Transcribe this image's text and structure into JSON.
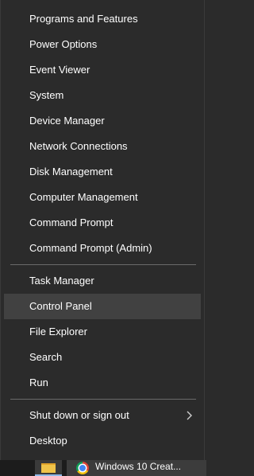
{
  "menu": {
    "group1": [
      {
        "label": "Programs and Features"
      },
      {
        "label": "Power Options"
      },
      {
        "label": "Event Viewer"
      },
      {
        "label": "System"
      },
      {
        "label": "Device Manager"
      },
      {
        "label": "Network Connections"
      },
      {
        "label": "Disk Management"
      },
      {
        "label": "Computer Management"
      },
      {
        "label": "Command Prompt"
      },
      {
        "label": "Command Prompt (Admin)"
      }
    ],
    "group2": [
      {
        "label": "Task Manager"
      },
      {
        "label": "Control Panel",
        "highlighted": true
      },
      {
        "label": "File Explorer"
      },
      {
        "label": "Search"
      },
      {
        "label": "Run"
      }
    ],
    "group3": [
      {
        "label": "Shut down or sign out",
        "submenu_icon": "chevron-right-icon"
      },
      {
        "label": "Desktop"
      }
    ]
  },
  "taskbar": {
    "items": [
      {
        "icon": "file-explorer-icon"
      },
      {
        "icon": "chrome-icon",
        "label": "Windows 10 Creat..."
      }
    ]
  },
  "colors": {
    "menu_bg": "#2b2b2b",
    "highlight": "#414141",
    "separator": "#6a6a6a",
    "text": "#ffffff"
  }
}
